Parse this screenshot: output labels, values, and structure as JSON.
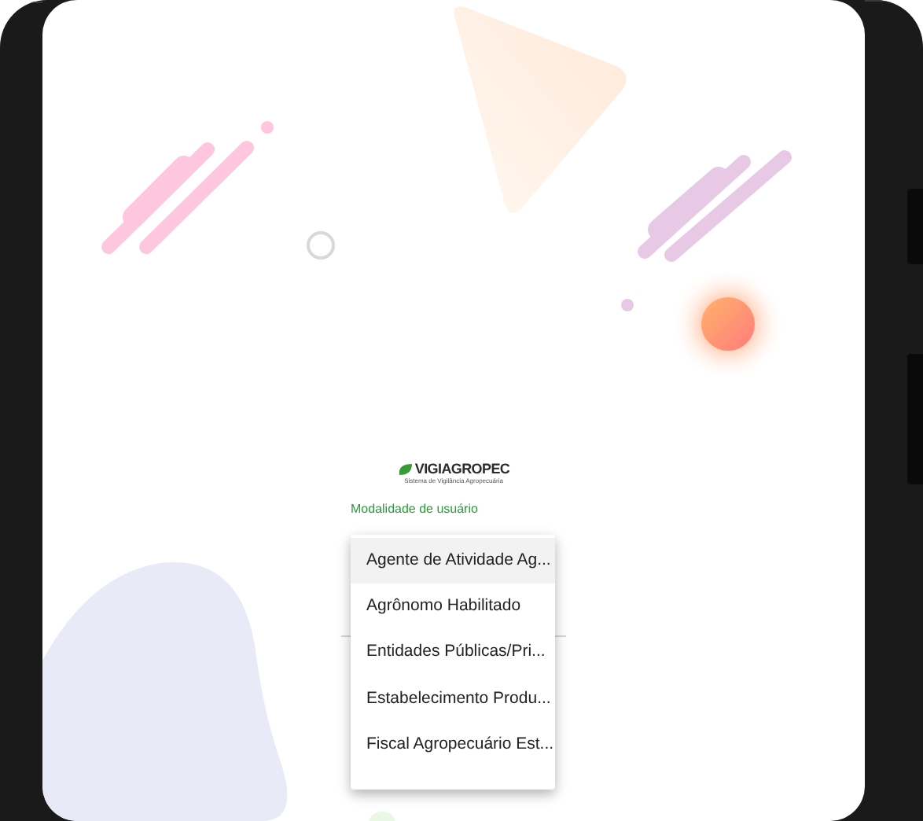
{
  "logo": {
    "name": "VIGIAGROPEC",
    "subtitle": "Sistema de Vigilância Agropecuária"
  },
  "user_type_field": {
    "label": "Modalidade de usuário"
  },
  "dropdown_menu": {
    "items": [
      {
        "label": "Agente de Atividade Ag...",
        "selected": true
      },
      {
        "label": "Agrônomo Habilitado",
        "selected": false
      },
      {
        "label": "Entidades Públicas/Pri...",
        "selected": false
      },
      {
        "label": "Estabelecimento Produ...",
        "selected": false
      },
      {
        "label": "Fiscal Agropecuário Est...",
        "selected": false
      }
    ]
  }
}
